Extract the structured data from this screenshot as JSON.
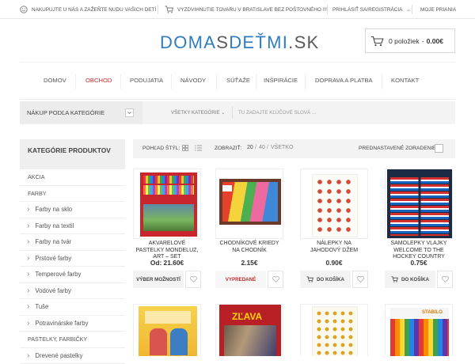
{
  "topbar": {
    "shop_text": "Nakupujte u nás a zažeňte nudu vašich detí",
    "pickup_text": "Vyzdvihnutie tovaru v Bratislave bez poštovného !!!",
    "login": "Prihlásiť sa/Registrácia",
    "wishlist": "Moje priania"
  },
  "header": {
    "logo_part1": "DOMA",
    "logo_part2": "S",
    "logo_part3": "DE",
    "logo_part4": "Ť",
    "logo_part5": "MI",
    "logo_part6": ".SK",
    "cart_count": "0 položiek",
    "cart_sep": "-",
    "cart_total": "0.00€"
  },
  "nav": [
    "Domov",
    "Obchod",
    "Podujatia",
    "Návody",
    "Súťaže",
    "Inšpirácie",
    "Doprava a platba",
    "Kontakt"
  ],
  "search": {
    "category_button": "Nákup podľa kategórie",
    "all_categories": "Všetky kategórie",
    "placeholder": "Tu zadajte kľúčové slová ..."
  },
  "sidebar": {
    "title": "Kategórie produktov",
    "items": [
      {
        "label": "Akcia",
        "type": "top"
      },
      {
        "label": "Farby",
        "type": "top"
      },
      {
        "label": "Farby na sklo",
        "type": "sub"
      },
      {
        "label": "Farby na textil",
        "type": "sub"
      },
      {
        "label": "Farby na tvár",
        "type": "sub"
      },
      {
        "label": "Prstové farby",
        "type": "sub"
      },
      {
        "label": "Temperové farby",
        "type": "sub"
      },
      {
        "label": "Vodové farby",
        "type": "sub"
      },
      {
        "label": "Tuše",
        "type": "sub"
      },
      {
        "label": "Potravinárske farby",
        "type": "sub"
      },
      {
        "label": "Pastelky, farbičky",
        "type": "top"
      },
      {
        "label": "Drevené pastelky",
        "type": "sub"
      }
    ]
  },
  "toolbar": {
    "view_label": "Pohľad štýl:",
    "show_label": "Zobraziť:",
    "show_20": "20",
    "show_sep": "/",
    "show_40": "40",
    "show_all": "Všetko",
    "sort_label": "Prednastavené zoradenie"
  },
  "products": [
    {
      "name": "Akvarelové pastelky Mondeluz, Art – Set",
      "price": "Od: 21.60€",
      "action": "Výber možností"
    },
    {
      "name": "Chodníkové kriedy na chodník",
      "price": "2.15€",
      "action": "Vypredané"
    },
    {
      "name": "Nálepky na jahodový džem",
      "price": "0.90€",
      "action": "Do košíka"
    },
    {
      "name": "Samolepky vlajky Welcome to the hockey country",
      "price": "0.75€",
      "action": "Do košíka"
    }
  ],
  "product_row2": {
    "zlava": "ZĽAVA",
    "stabilo": "STABILO"
  },
  "colors": {
    "accent": "#2f7dc0",
    "active_nav": "#c02a2a"
  }
}
